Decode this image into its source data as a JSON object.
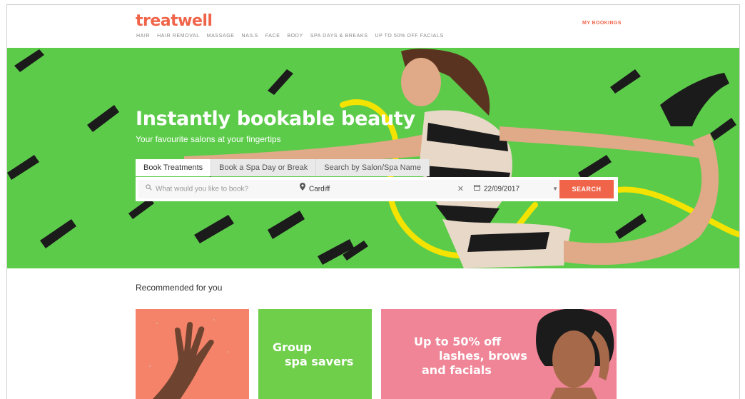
{
  "header": {
    "logo": "treatwell",
    "nav": [
      "HAIR",
      "HAIR REMOVAL",
      "MASSAGE",
      "NAILS",
      "FACE",
      "BODY",
      "SPA DAYS & BREAKS",
      "UP TO 50% OFF FACIALS"
    ],
    "my_bookings": "MY BOOKINGS",
    "accent_color": "#f06449"
  },
  "hero": {
    "title": "Instantly bookable beauty",
    "subtitle": "Your favourite salons at your fingertips",
    "background_color": "#5ccb4a",
    "tabs": [
      "Book Treatments",
      "Book a Spa Day or Break",
      "Search by Salon/Spa Name"
    ],
    "active_tab": "Book Treatments",
    "search": {
      "treatment_placeholder": "What would you like to book?",
      "location_value": "Cardiff",
      "date_value": "22/09/2017",
      "button_label": "SEARCH",
      "icons": [
        "search-icon",
        "location-pin-icon",
        "clear-icon",
        "calendar-icon",
        "chevron-down-icon"
      ]
    }
  },
  "recommended": {
    "title": "Recommended for you",
    "cards": [
      {
        "image": "hand-nails"
      },
      {
        "line1": "Group",
        "line2": "spa savers"
      },
      {
        "line1": "Up to 50% off",
        "line2": "lashes, brows",
        "line3": "and facials",
        "image": "woman-portrait"
      }
    ]
  }
}
